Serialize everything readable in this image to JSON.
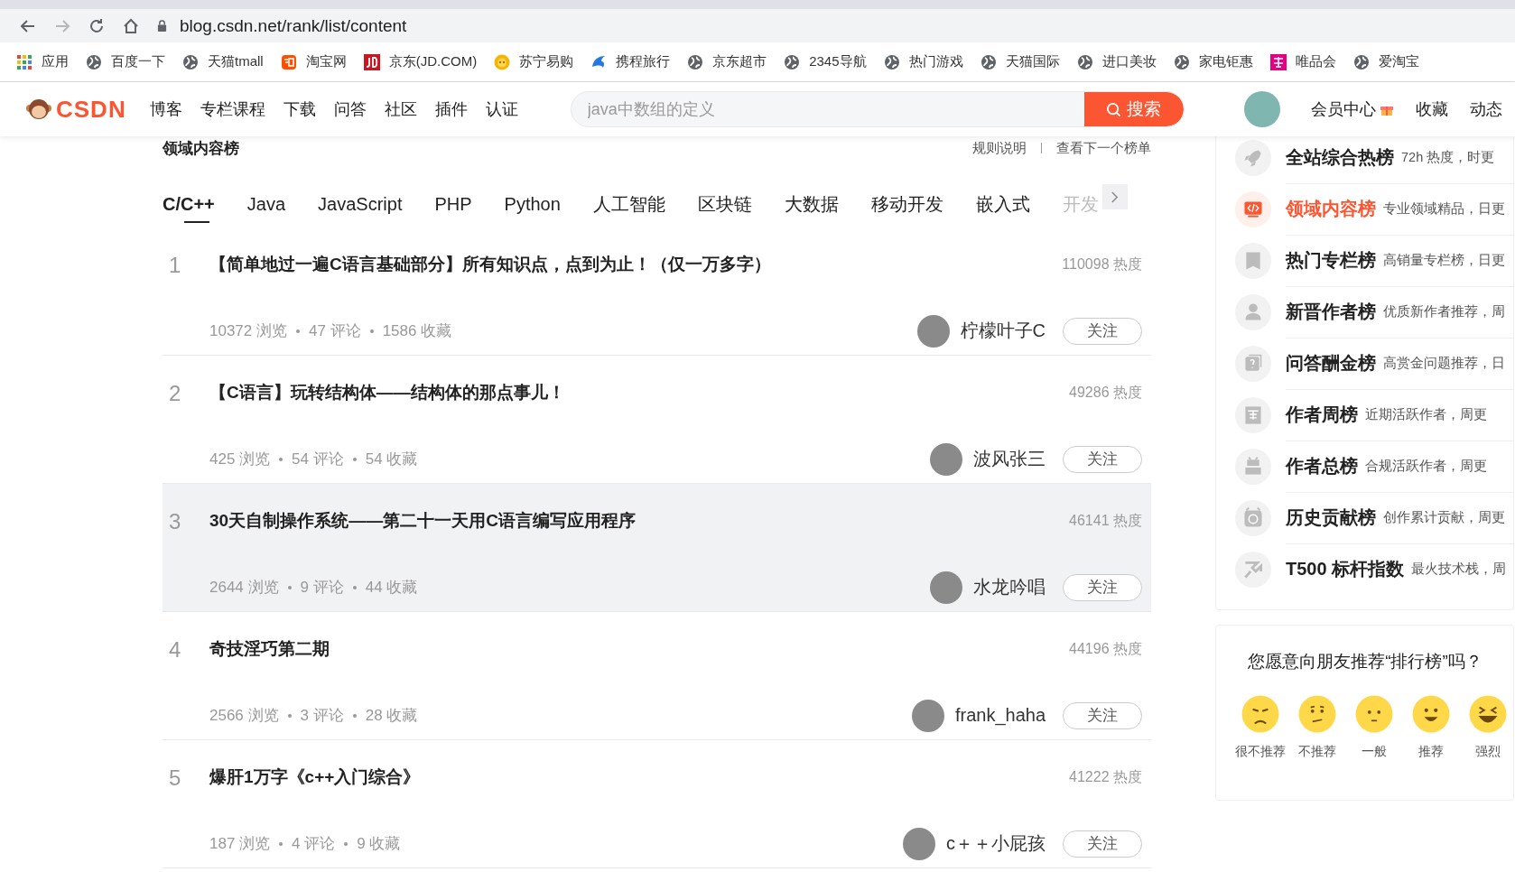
{
  "browser": {
    "url": "blog.csdn.net/rank/list/content",
    "bookmarks": [
      {
        "kind": "apps",
        "label": "应用"
      },
      {
        "kind": "globe",
        "label": "百度一下"
      },
      {
        "kind": "globe",
        "label": "天猫tmall"
      },
      {
        "kind": "taobao",
        "label": "淘宝网"
      },
      {
        "kind": "jd",
        "label": "京东(JD.COM)"
      },
      {
        "kind": "suning",
        "label": "苏宁易购"
      },
      {
        "kind": "ctrip",
        "label": "携程旅行"
      },
      {
        "kind": "globe",
        "label": "京东超市"
      },
      {
        "kind": "globe",
        "label": "2345导航"
      },
      {
        "kind": "globe",
        "label": "热门游戏"
      },
      {
        "kind": "globe",
        "label": "天猫国际"
      },
      {
        "kind": "globe",
        "label": "进口美妆"
      },
      {
        "kind": "globe",
        "label": "家电钜惠"
      },
      {
        "kind": "vip",
        "label": "唯品会"
      },
      {
        "kind": "globe",
        "label": "爱淘宝"
      }
    ]
  },
  "header": {
    "logo": "CSDN",
    "nav": [
      "博客",
      "专栏课程",
      "下载",
      "问答",
      "社区",
      "插件",
      "认证"
    ],
    "search": {
      "placeholder": "java中数组的定义",
      "button": "搜索"
    },
    "links": [
      {
        "label": "会员中心",
        "kind": "gift"
      },
      {
        "label": "收藏",
        "kind": "plain"
      },
      {
        "label": "动态",
        "kind": "plain"
      }
    ]
  },
  "board": {
    "title": "领域内容榜",
    "actions": [
      "规则说明",
      "查看下一个榜单"
    ],
    "tabs": [
      {
        "label": "C/C++",
        "selected": true
      },
      {
        "label": "Java",
        "selected": false
      },
      {
        "label": "JavaScript",
        "selected": false
      },
      {
        "label": "PHP",
        "selected": false
      },
      {
        "label": "Python",
        "selected": false
      },
      {
        "label": "人工智能",
        "selected": false
      },
      {
        "label": "区块链",
        "selected": false
      },
      {
        "label": "大数据",
        "selected": false
      },
      {
        "label": "移动开发",
        "selected": false
      },
      {
        "label": "嵌入式",
        "selected": false
      },
      {
        "label": "开发",
        "selected": false
      }
    ],
    "items": [
      {
        "rank": "1",
        "title": "【简单地过一遍C语言基础部分】所有知识点，点到为止！（仅一万多字）",
        "heat": "110098 热度",
        "stats": [
          "10372 浏览",
          "47 评论",
          "1586 收藏"
        ],
        "author": "柠檬叶子C",
        "follow": "关注",
        "hovered": false
      },
      {
        "rank": "2",
        "title": "【C语言】玩转结构体——结构体的那点事儿！",
        "heat": "49286 热度",
        "stats": [
          "425 浏览",
          "54 评论",
          "54 收藏"
        ],
        "author": "波风张三",
        "follow": "关注",
        "hovered": false
      },
      {
        "rank": "3",
        "title": "30天自制操作系统——第二十一天用C语言编写应用程序",
        "heat": "46141 热度",
        "stats": [
          "2644 浏览",
          "9 评论",
          "44 收藏"
        ],
        "author": "水龙吟唱",
        "follow": "关注",
        "hovered": true
      },
      {
        "rank": "4",
        "title": "奇技淫巧第二期",
        "heat": "44196 热度",
        "stats": [
          "2566 浏览",
          "3 评论",
          "28 收藏"
        ],
        "author": "frank_haha",
        "follow": "关注",
        "hovered": false
      },
      {
        "rank": "5",
        "title": "爆肝1万字《c++入门综合》",
        "heat": "41222 热度",
        "stats": [
          "187 浏览",
          "4 评论",
          "9 收藏"
        ],
        "author": "c＋＋小屁孩",
        "follow": "关注",
        "hovered": false
      }
    ]
  },
  "sidebar": {
    "boards": [
      {
        "kind": "rocket",
        "title": "全站综合热榜",
        "desc": "72h 热度，时更",
        "selected": false
      },
      {
        "kind": "code",
        "title": "领域内容榜",
        "desc": "专业领域精品，日更",
        "selected": true
      },
      {
        "kind": "book",
        "title": "热门专栏榜",
        "desc": "高销量专栏榜，日更",
        "selected": false
      },
      {
        "kind": "user",
        "title": "新晋作者榜",
        "desc": "优质新作者推荐，周",
        "selected": false
      },
      {
        "kind": "question",
        "title": "问答酬金榜",
        "desc": "高赏金问题推荐，日",
        "selected": false
      },
      {
        "kind": "calendar",
        "title": "作者周榜",
        "desc": "近期活跃作者，周更",
        "selected": false
      },
      {
        "kind": "stack",
        "title": "作者总榜",
        "desc": "合规活跃作者，周更",
        "selected": false
      },
      {
        "kind": "clock",
        "title": "历史贡献榜",
        "desc": "创作累计贡献，周更",
        "selected": false
      },
      {
        "kind": "trend",
        "title": "T500 标杆指数",
        "desc": "最火技术栈，周",
        "selected": false
      }
    ],
    "feedback": {
      "question": "您愿意向朋友推荐“排行榜”吗？",
      "options": [
        {
          "kind": "angry",
          "label": "很不推荐"
        },
        {
          "kind": "unhappy",
          "label": "不推荐"
        },
        {
          "kind": "neutral",
          "label": "一般"
        },
        {
          "kind": "smile",
          "label": "推荐"
        },
        {
          "kind": "laugh",
          "label": "强烈"
        }
      ]
    }
  }
}
